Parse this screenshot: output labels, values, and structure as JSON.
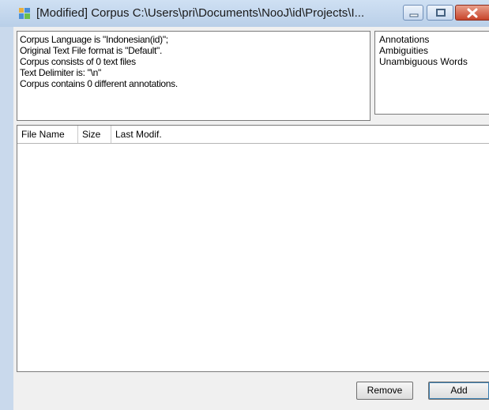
{
  "window": {
    "title": "[Modified] Corpus C:\\Users\\pri\\Documents\\NooJ\\id\\Projects\\I...",
    "icon": "nooj-app-icon",
    "controls": {
      "minimize_icon": "minimize-icon",
      "maximize_icon": "maximize-icon",
      "close_icon": "close-icon"
    }
  },
  "info": {
    "lines": [
      "Corpus Language is \"Indonesian(id)\";",
      "Original Text File format is \"Default\".",
      "Corpus consists of 0 text files",
      "Text Delimiter is: \"\\n\"",
      "Corpus  contains 0 different annotations."
    ]
  },
  "annotations_list": {
    "items": [
      "Annotations",
      "Ambiguities",
      "Unambiguous Words"
    ]
  },
  "file_list": {
    "columns": [
      "File Name",
      "Size",
      "Last Modif."
    ],
    "rows": []
  },
  "buttons": {
    "remove": "Remove",
    "add": "Add"
  },
  "colors": {
    "titlebar": "#c9d9ec",
    "close_button": "#c7442a",
    "client_background": "#f0f0f0"
  }
}
